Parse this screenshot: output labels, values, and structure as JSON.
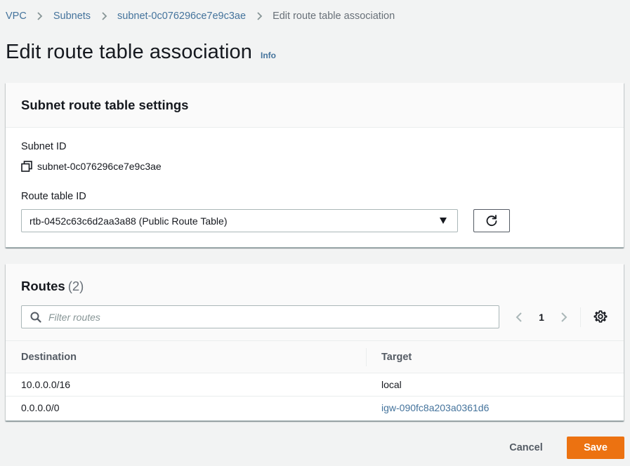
{
  "breadcrumb": {
    "items": [
      "VPC",
      "Subnets",
      "subnet-0c076296ce7e9c3ae"
    ],
    "current": "Edit route table association"
  },
  "page": {
    "title": "Edit route table association",
    "info_label": "Info"
  },
  "settings": {
    "title": "Subnet route table settings",
    "subnet_id_label": "Subnet ID",
    "subnet_id_value": "subnet-0c076296ce7e9c3ae",
    "route_table_label": "Route table ID",
    "route_table_selected": "rtb-0452c63c6d2aa3a88 (Public Route Table)"
  },
  "routes": {
    "title": "Routes",
    "count": "(2)",
    "filter_placeholder": "Filter routes",
    "page_number": "1",
    "columns": [
      "Destination",
      "Target"
    ],
    "rows": [
      {
        "destination": "10.0.0.0/16",
        "target": "local",
        "target_is_link": false
      },
      {
        "destination": "0.0.0.0/0",
        "target": "igw-090fc8a203a0361d6",
        "target_is_link": true
      }
    ]
  },
  "footer": {
    "cancel_label": "Cancel",
    "save_label": "Save"
  },
  "colors": {
    "link": "#44739c",
    "primary_button": "#ec7211",
    "background": "#f2f3f3"
  },
  "icons": [
    "chevron-right-icon",
    "copy-icon",
    "caret-down-icon",
    "refresh-icon",
    "search-icon",
    "chevron-left-icon",
    "gear-icon"
  ]
}
